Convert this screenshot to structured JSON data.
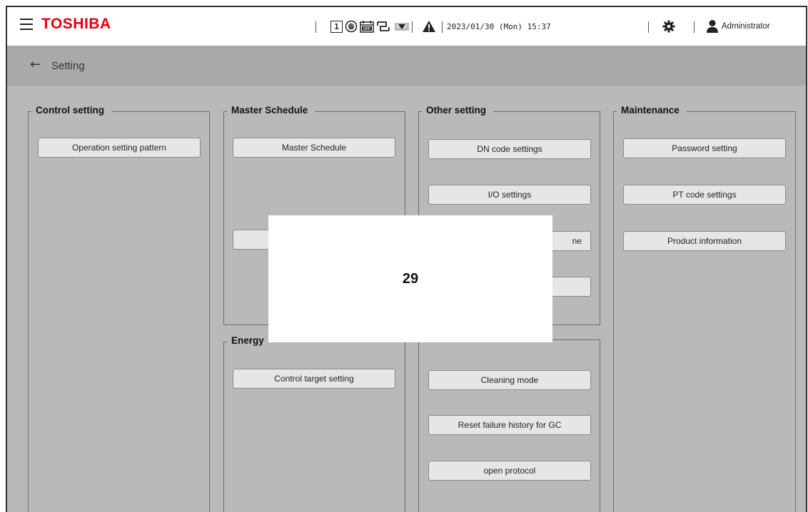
{
  "header": {
    "brand": "TOSHIBA",
    "status_one": "1",
    "status_off_badge": "OFF",
    "datetime": "2023/01/30 (Mon) 15:37",
    "user": "Administrator",
    "icons": [
      "menu-icon",
      "mode-one-icon",
      "manual-hand-icon",
      "calendar-off-icon",
      "interlock-icon",
      "off-badge-icon",
      "dropdown-caret-icon",
      "warning-icon",
      "gear-icon",
      "user-icon"
    ]
  },
  "subheader": {
    "title": "Setting"
  },
  "groups": {
    "control": {
      "title": "Control setting",
      "buttons": [
        "Operation setting pattern"
      ]
    },
    "master": {
      "title": "Master Schedule",
      "buttons": [
        "Master Schedule"
      ]
    },
    "energy": {
      "title_visible": "Energy",
      "buttons": [
        "Control target setting"
      ]
    },
    "other": {
      "title": "Other setting",
      "buttons": [
        "DN code settings",
        "I/O settings"
      ],
      "partial_suffix": "ne"
    },
    "lower_other": {
      "buttons": [
        "Cleaning mode",
        "Reset failure history for GC",
        "open protocol"
      ]
    },
    "maintenance": {
      "title": "Maintenance",
      "buttons": [
        "Password setting",
        "PT code settings",
        "Product information"
      ]
    }
  },
  "overlay": {
    "value": "29"
  },
  "colors": {
    "brand": "#e60012",
    "background": "#b9b9b9",
    "subbar": "#a9a9a9",
    "button": "#e6e6e6"
  }
}
